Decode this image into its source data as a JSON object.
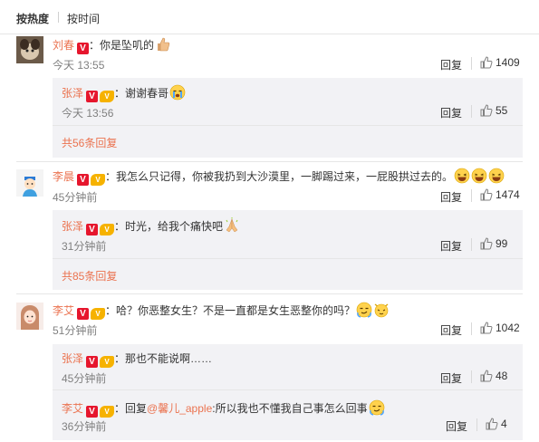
{
  "sort": {
    "hot_label": "按热度",
    "time_label": "按时间"
  },
  "comments": [
    {
      "user": "刘春",
      "text": "：你是坠叽的",
      "time": "今天 13:55",
      "reply_label": "回复",
      "likes": "1409",
      "replies": [
        {
          "user": "张泽",
          "text": "：谢谢春哥",
          "time": "今天 13:56",
          "reply_label": "回复",
          "likes": "55"
        }
      ],
      "more": "共56条回复"
    },
    {
      "user": "李晨",
      "text": "：我怎么只记得，你被我扔到大沙漠里，一脚踢过来，一屁股拱过去的。",
      "time": "45分钟前",
      "reply_label": "回复",
      "likes": "1474",
      "replies": [
        {
          "user": "张泽",
          "text": "：时光，给我个痛快吧",
          "time": "31分钟前",
          "reply_label": "回复",
          "likes": "99"
        }
      ],
      "more": "共85条回复"
    },
    {
      "user": "李艾",
      "text": "：哈？你恶整女生？不是一直都是女生恶整你的吗？",
      "time": "51分钟前",
      "reply_label": "回复",
      "likes": "1042",
      "replies": [
        {
          "user": "张泽",
          "text": "：那也不能说啊……",
          "time": "45分钟前",
          "reply_label": "回复",
          "likes": "48"
        },
        {
          "user": "李艾",
          "text_prefix": "：回复",
          "mention": "@馨儿_apple",
          "text": ":所以我也不懂我自己事怎么回事",
          "time": "36分钟前",
          "reply_label": "回复",
          "likes": "4"
        }
      ]
    }
  ],
  "badges": {
    "verified": "V",
    "vip": "V"
  },
  "icons": [
    "thumbs-up-icon",
    "verified-badge-icon",
    "vip-badge-icon"
  ],
  "colors": {
    "username": "#eb7350",
    "link": "#eb7350",
    "time": "#808080",
    "reply_bg": "#f2f2f5"
  }
}
